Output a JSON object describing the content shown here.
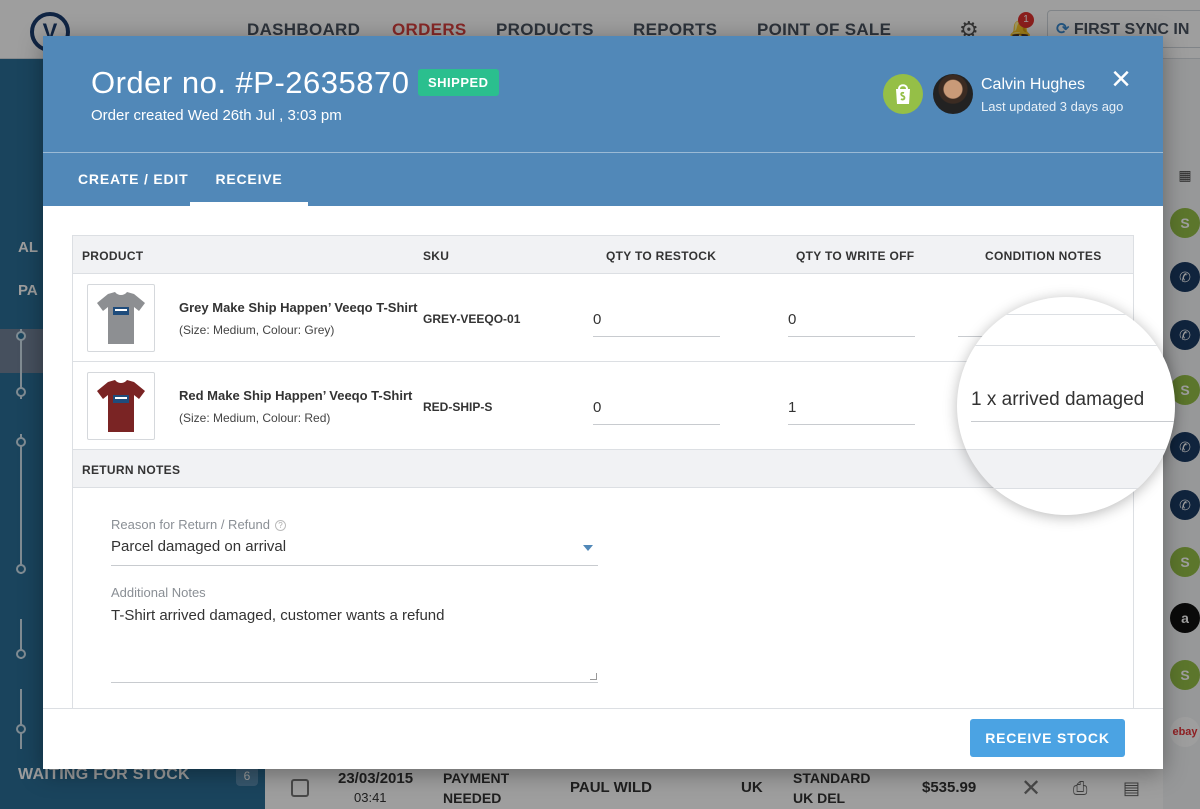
{
  "app": {
    "logo": "V",
    "nav": [
      "DASHBOARD",
      "ORDERS",
      "PRODUCTS",
      "REPORTS",
      "POINT OF SALE"
    ],
    "notification_count": "1",
    "sync_label": "FIRST SYNC IN"
  },
  "sidebar": {
    "labels": [
      "AL",
      "PA"
    ],
    "waiting_label": "WAITING FOR STOCK",
    "waiting_count": "6"
  },
  "bg_row": {
    "date": "23/03/2015",
    "time": "03:41",
    "status_line1": "PAYMENT",
    "status_line2": "NEEDED",
    "customer": "PAUL WILD",
    "country": "UK",
    "shipping_line1": "STANDARD",
    "shipping_line2": "UK DEL",
    "total": "$535.99"
  },
  "modal": {
    "title": "Order no. #P-2635870",
    "status_badge": "SHIPPED",
    "created": "Order created Wed 26th Jul , 3:03 pm",
    "user_name": "Calvin Hughes",
    "last_updated": "Last updated 3 days ago",
    "close_icon": "×",
    "tabs": [
      "CREATE / EDIT",
      "RECEIVE"
    ],
    "active_tab": "RECEIVE"
  },
  "table": {
    "headers": [
      "PRODUCT",
      "SKU",
      "QTY TO RESTOCK",
      "QTY TO WRITE OFF",
      "CONDITION NOTES"
    ],
    "rows": [
      {
        "name": "Grey Make Ship Happen’ Veeqo T-Shirt",
        "variant": "(Size: Medium, Colour: Grey)",
        "sku": "GREY-VEEQO-01",
        "qty_restock": "0",
        "qty_write_off": "0",
        "condition_notes": "",
        "shirt_color": "#8d8f92"
      },
      {
        "name": "Red Make Ship Happen’ Veeqo T-Shirt",
        "variant": "(Size: Medium, Colour: Red)",
        "sku": "RED-SHIP-S",
        "qty_restock": "0",
        "qty_write_off": "1",
        "condition_notes": "1 x arrived damaged",
        "shirt_color": "#7a2424"
      }
    ]
  },
  "return_notes": {
    "heading": "RETURN NOTES",
    "reason_label": "Reason for Return / Refund",
    "reason_value": "Parcel damaged on arrival",
    "notes_label": "Additional Notes",
    "notes_value": "T-Shirt arrived damaged, customer wants a refund"
  },
  "footer": {
    "receive_button": "RECEIVE STOCK"
  },
  "colors": {
    "header_blue": "#5188b8",
    "shipped_green": "#2bbf8e",
    "button_blue": "#4ba3e3",
    "orders_red": "#d8423f"
  }
}
